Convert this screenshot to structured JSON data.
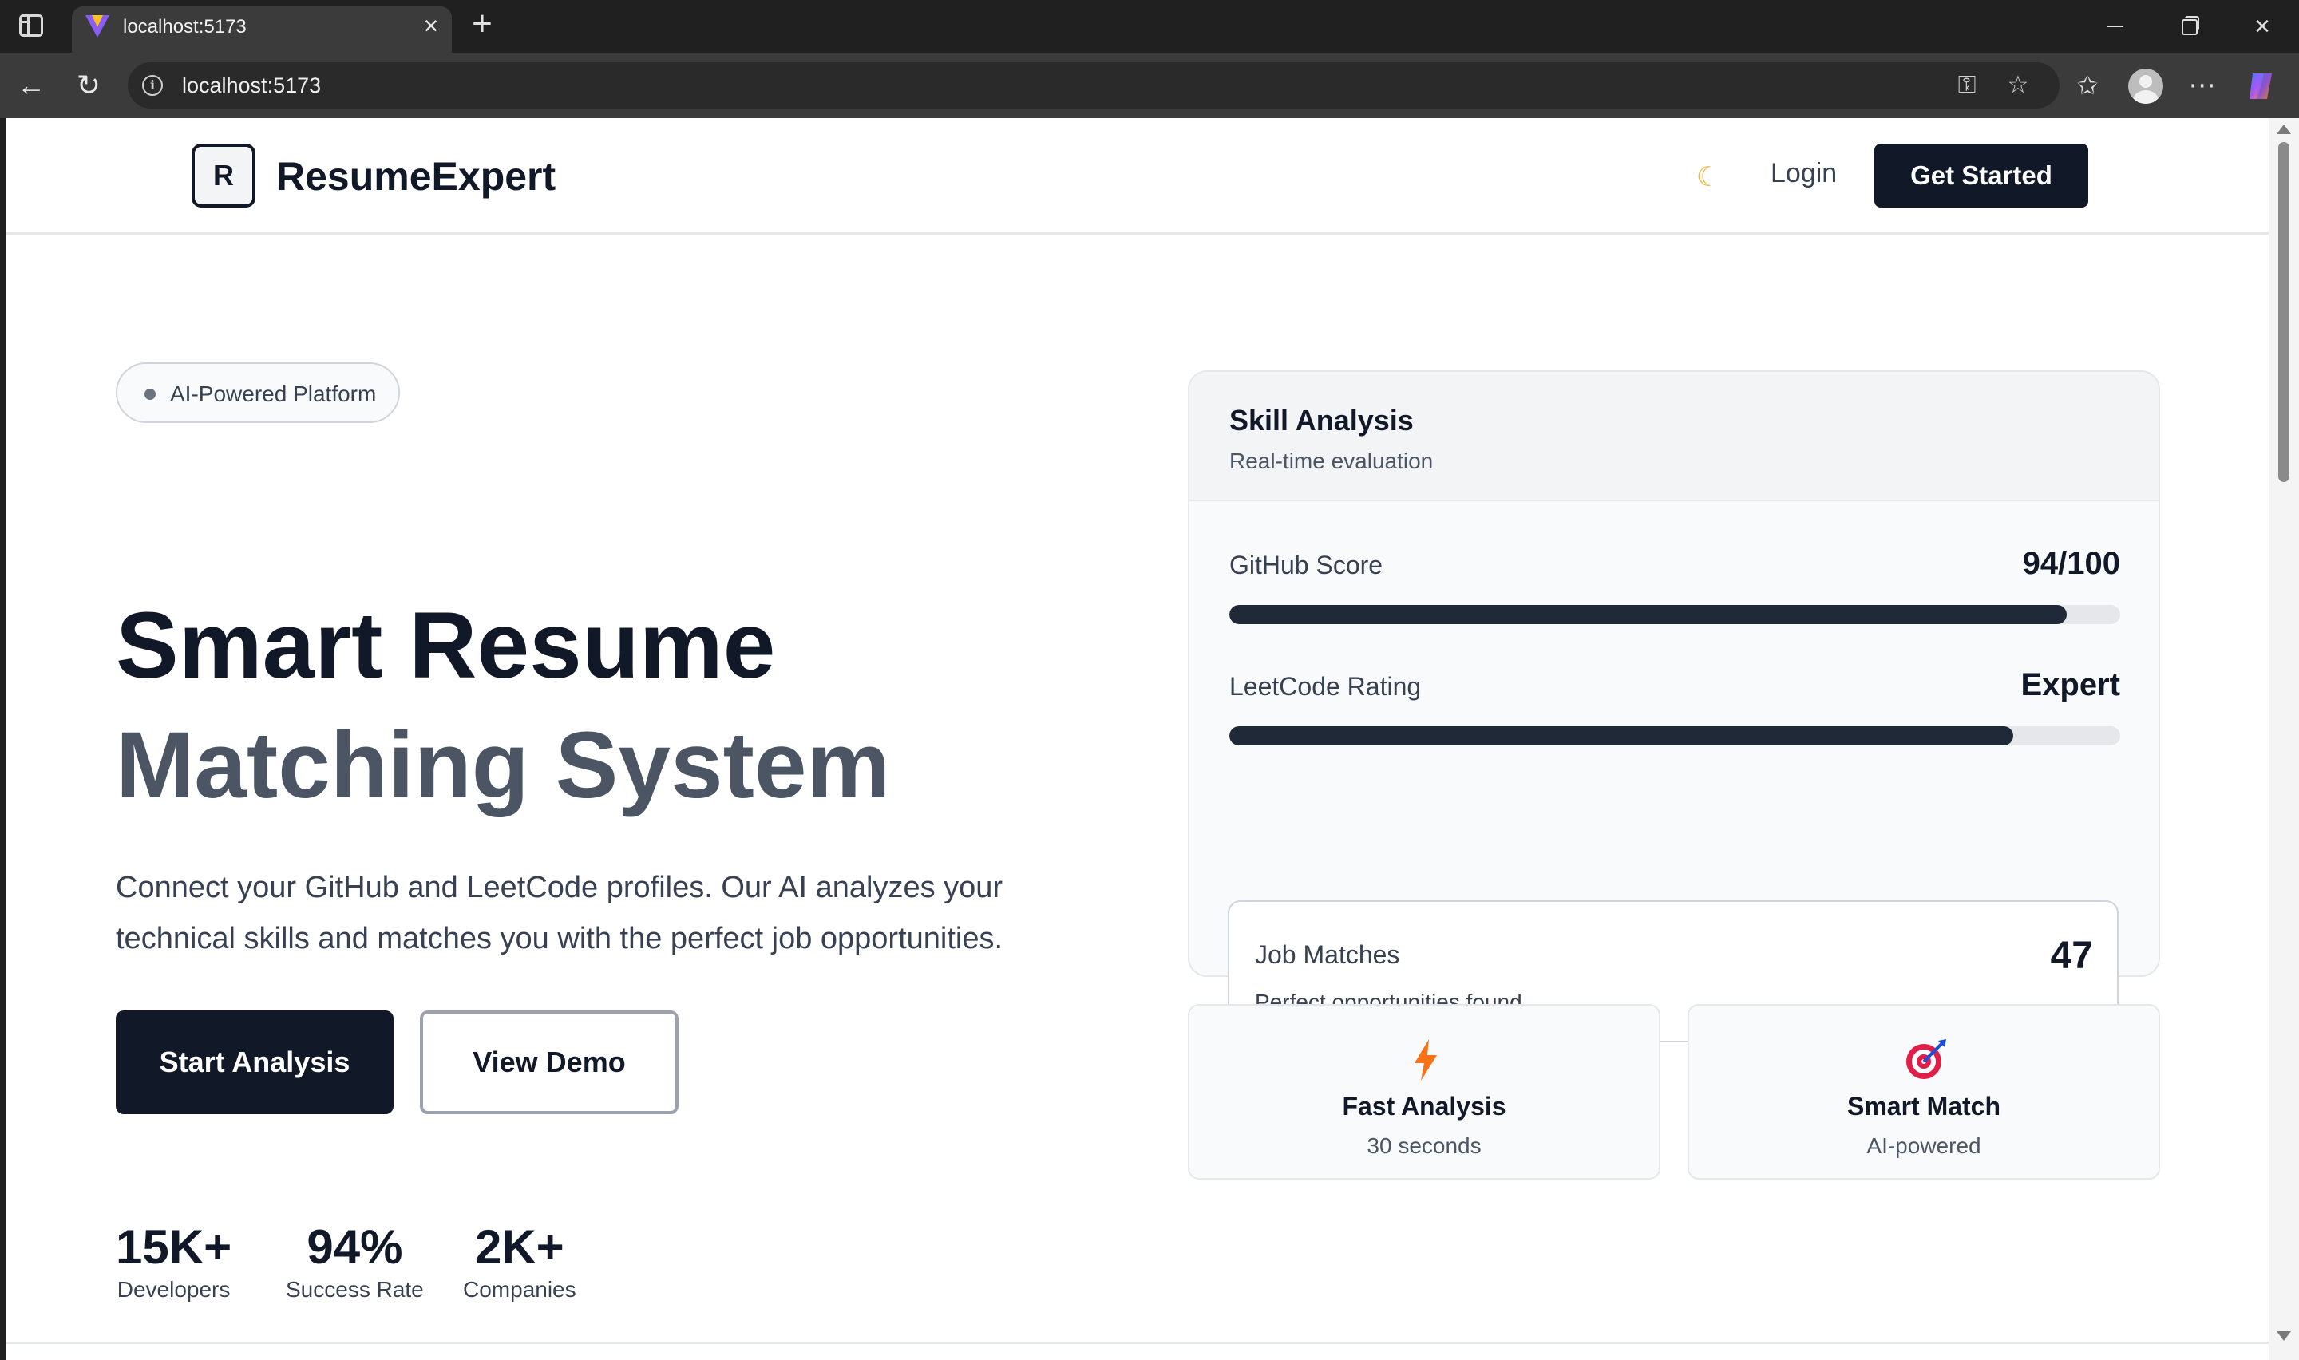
{
  "browser": {
    "tab_title": "localhost:5173",
    "url": "localhost:5173",
    "close_glyph": "×",
    "new_tab_glyph": "+"
  },
  "header": {
    "logo_letter": "R",
    "brand": "ResumeExpert",
    "login": "Login",
    "get_started": "Get Started",
    "theme_icon": "moon-icon"
  },
  "hero": {
    "badge": "AI-Powered Platform",
    "title_line1": "Smart Resume",
    "title_line2": "Matching System",
    "description": "Connect your GitHub and LeetCode profiles. Our AI analyzes your technical skills and matches you with the perfect job opportunities.",
    "primary_button": "Start Analysis",
    "secondary_button": "View Demo",
    "stats": [
      {
        "value": "15K+",
        "label": "Developers"
      },
      {
        "value": "94%",
        "label": "Success Rate"
      },
      {
        "value": "2K+",
        "label": "Companies"
      }
    ]
  },
  "skill_card": {
    "title": "Skill Analysis",
    "subtitle": "Real-time evaluation",
    "metrics": [
      {
        "label": "GitHub Score",
        "value": "94/100",
        "progress": 0.94
      },
      {
        "label": "LeetCode Rating",
        "value": "Expert",
        "progress": 0.88
      }
    ],
    "matches": {
      "label": "Job Matches",
      "sub": "Perfect opportunities found",
      "value": "47"
    }
  },
  "features": [
    {
      "title": "Fast Analysis",
      "sub": "30 seconds",
      "icon": "lightning-icon",
      "color": "#f97316"
    },
    {
      "title": "Smart Match",
      "sub": "AI-powered",
      "icon": "target-icon",
      "color": "#e11d48"
    }
  ],
  "colors": {
    "primary": "#111827",
    "secondary_text": "#4b5563",
    "accent": "#f2b340"
  }
}
